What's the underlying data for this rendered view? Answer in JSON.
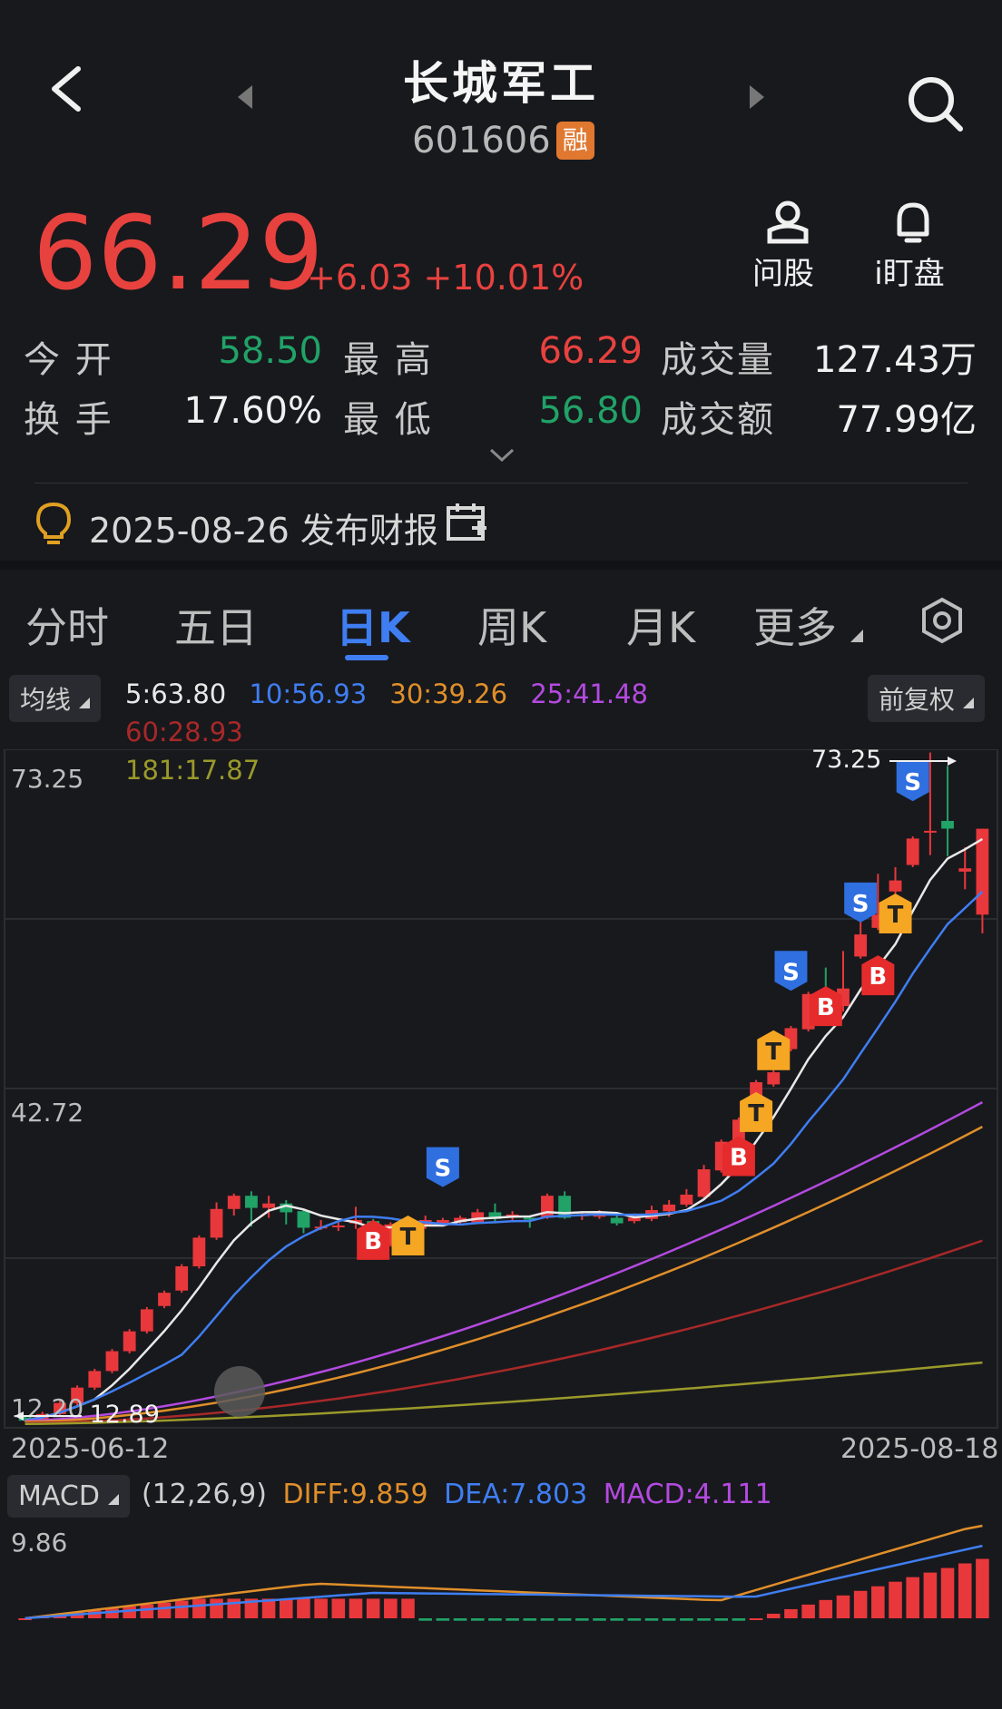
{
  "header": {
    "title": "长城军工",
    "code": "601606",
    "badge": "融",
    "price": "66.29",
    "change": "+6.03",
    "change_pct": "+10.01%",
    "ask_label": "问股",
    "monitor_label": "i盯盘"
  },
  "stats": {
    "open_label": "今 开",
    "open": "58.50",
    "high_label": "最 高",
    "high": "66.29",
    "volume_label": "成交量",
    "volume": "127.43万",
    "turnover_label": "换 手",
    "turnover": "17.60%",
    "low_label": "最 低",
    "low": "56.80",
    "amount_label": "成交额",
    "amount": "77.99亿"
  },
  "report": {
    "text": "2025-08-26 发布财报"
  },
  "tabs": [
    {
      "label": "分时",
      "active": false
    },
    {
      "label": "五日",
      "active": false
    },
    {
      "label": "日K",
      "active": true
    },
    {
      "label": "周K",
      "active": false
    },
    {
      "label": "月K",
      "active": false
    },
    {
      "label": "更多",
      "active": false
    }
  ],
  "ma": {
    "button": "均线",
    "adjust": "前复权",
    "items": [
      {
        "text": "5:63.80",
        "color": "#e8e8e8"
      },
      {
        "text": "10:56.93",
        "color": "#3f7ef2"
      },
      {
        "text": "30:39.26",
        "color": "#e08f2a"
      },
      {
        "text": "25:41.48",
        "color": "#b44ae0"
      },
      {
        "text": "60:28.93",
        "color": "#a82828"
      },
      {
        "text": "181:17.87",
        "color": "#9a9a2a"
      }
    ]
  },
  "chart": {
    "y_labels": [
      "73.25",
      "42.72",
      "12.20"
    ],
    "max_marker": "73.25",
    "min_marker": "12.89",
    "start_date": "2025-06-12",
    "end_date": "2025-08-18"
  },
  "macd": {
    "button": "MACD",
    "params": "(12,26,9)",
    "diff": "DIFF:9.859",
    "dea": "DEA:7.803",
    "macd": "MACD:4.111",
    "y_label": "9.86",
    "diff_color": "#e08f2a",
    "dea_color": "#3f7ef2",
    "macd_color": "#b44ae0"
  },
  "signals": [
    "S",
    "T",
    "B"
  ],
  "chart_data": {
    "type": "candlestick",
    "x_start": "2025-06-12",
    "x_end": "2025-08-18",
    "ylim": [
      12.2,
      73.25
    ],
    "max": 73.25,
    "min": 12.89,
    "candles": [
      [
        12.9,
        12.6,
        13.1,
        12.5
      ],
      [
        12.6,
        13.2,
        13.4,
        12.4
      ],
      [
        13.2,
        14.2,
        14.4,
        13.0
      ],
      [
        14.2,
        15.6,
        15.8,
        14.0
      ],
      [
        15.6,
        17.1,
        17.3,
        15.4
      ],
      [
        17.1,
        18.9,
        19.1,
        16.9
      ],
      [
        18.9,
        20.7,
        20.9,
        18.7
      ],
      [
        20.7,
        22.7,
        22.9,
        20.5
      ],
      [
        23.0,
        24.2,
        24.4,
        22.8
      ],
      [
        24.4,
        26.6,
        26.8,
        24.2
      ],
      [
        26.6,
        29.2,
        29.4,
        26.4
      ],
      [
        29.2,
        31.8,
        32.4,
        29.0
      ],
      [
        31.8,
        33.0,
        33.2,
        31.2
      ],
      [
        33.0,
        31.9,
        33.4,
        30.2
      ],
      [
        31.9,
        32.3,
        33.0,
        31.0
      ],
      [
        32.3,
        31.5,
        32.6,
        30.4
      ],
      [
        31.6,
        30.1,
        31.8,
        29.6
      ],
      [
        30.1,
        30.2,
        30.8,
        29.9
      ],
      [
        30.2,
        30.3,
        30.6,
        29.8
      ],
      [
        30.5,
        30.8,
        32.0,
        30.0
      ],
      [
        30.7,
        29.0,
        30.9,
        28.6
      ],
      [
        28.6,
        30.4,
        30.6,
        28.4
      ],
      [
        29.8,
        30.5,
        31.0,
        29.4
      ],
      [
        30.4,
        30.8,
        31.2,
        30.0
      ],
      [
        30.5,
        30.8,
        31.0,
        30.2
      ],
      [
        30.6,
        31.0,
        31.2,
        30.3
      ],
      [
        30.6,
        31.5,
        31.8,
        30.5
      ],
      [
        31.5,
        30.9,
        32.3,
        30.5
      ],
      [
        31.1,
        31.3,
        31.6,
        30.8
      ],
      [
        31.0,
        30.9,
        31.2,
        30.1
      ],
      [
        31.0,
        33.0,
        33.2,
        30.9
      ],
      [
        33.0,
        31.0,
        33.4,
        30.9
      ],
      [
        31.2,
        31.3,
        31.6,
        30.8
      ],
      [
        31.1,
        31.4,
        31.7,
        30.9
      ],
      [
        31.0,
        30.5,
        31.5,
        30.3
      ],
      [
        30.7,
        31.0,
        31.4,
        30.5
      ],
      [
        30.9,
        31.7,
        32.1,
        30.7
      ],
      [
        31.6,
        32.2,
        32.6,
        31.1
      ],
      [
        32.2,
        33.1,
        33.6,
        32.0
      ],
      [
        32.9,
        35.4,
        35.8,
        32.7
      ],
      [
        35.3,
        37.9,
        38.1,
        35.1
      ],
      [
        37.7,
        39.9,
        40.1,
        37.5
      ],
      [
        40.2,
        43.3,
        43.5,
        40.0
      ],
      [
        43.1,
        44.2,
        44.4,
        42.9
      ],
      [
        46.3,
        48.2,
        48.4,
        46.1
      ],
      [
        48.1,
        51.3,
        51.5,
        47.9
      ],
      [
        51.3,
        50.5,
        53.7,
        49.9
      ],
      [
        50.2,
        51.8,
        55.2,
        49.7
      ],
      [
        54.7,
        56.7,
        59.4,
        54.5
      ],
      [
        57.3,
        58.5,
        62.2,
        57.1
      ],
      [
        60.6,
        61.6,
        62.8,
        60.4
      ],
      [
        63.0,
        65.4,
        65.6,
        62.8
      ],
      [
        66.0,
        66.1,
        73.2,
        63.9
      ],
      [
        67.0,
        66.3,
        72.0,
        63.8
      ],
      [
        62.4,
        62.7,
        64.6,
        60.8
      ],
      [
        58.5,
        66.29,
        66.3,
        56.8
      ]
    ],
    "ma_lines": [
      {
        "name": "5",
        "last": 63.8
      },
      {
        "name": "10",
        "last": 56.93
      },
      {
        "name": "30",
        "last": 39.26
      },
      {
        "name": "25",
        "last": 41.48
      },
      {
        "name": "60",
        "last": 28.93
      },
      {
        "name": "181",
        "last": 17.87
      }
    ]
  }
}
